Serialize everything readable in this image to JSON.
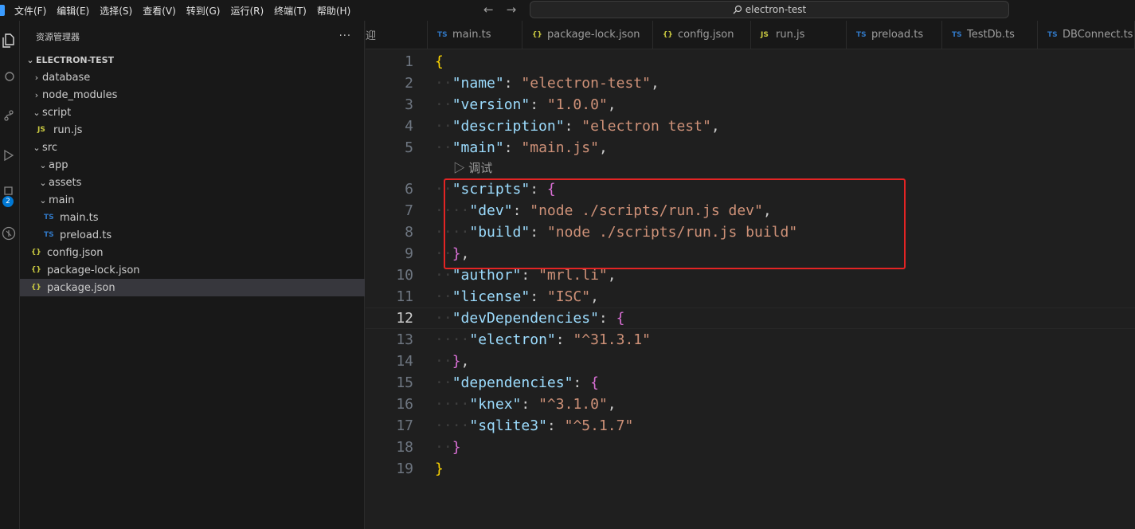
{
  "titlebar": {
    "menus": [
      "文件(F)",
      "编辑(E)",
      "选择(S)",
      "查看(V)",
      "转到(G)",
      "运行(R)",
      "终端(T)",
      "帮助(H)"
    ],
    "search_text": "electron-test"
  },
  "sidebar": {
    "title": "资源管理器",
    "more": "···",
    "root": "ELECTRON-TEST",
    "items": [
      {
        "label": "database",
        "kind": "folder-collapsed"
      },
      {
        "label": "node_modules",
        "kind": "folder-collapsed"
      },
      {
        "label": "script",
        "kind": "folder-open"
      },
      {
        "label": "run.js",
        "kind": "js"
      },
      {
        "label": "src",
        "kind": "folder-open"
      },
      {
        "label": "app",
        "kind": "folder-open"
      },
      {
        "label": "assets",
        "kind": "folder-open"
      },
      {
        "label": "main",
        "kind": "folder-open"
      },
      {
        "label": "main.ts",
        "kind": "ts"
      },
      {
        "label": "preload.ts",
        "kind": "ts"
      },
      {
        "label": "config.json",
        "kind": "json"
      },
      {
        "label": "package-lock.json",
        "kind": "json"
      },
      {
        "label": "package.json",
        "kind": "json",
        "selected": true
      }
    ],
    "badge_count": "2"
  },
  "tabs": [
    {
      "label": "迎",
      "kind": ""
    },
    {
      "label": "main.ts",
      "kind": "ts"
    },
    {
      "label": "package-lock.json",
      "kind": "json"
    },
    {
      "label": "config.json",
      "kind": "json"
    },
    {
      "label": "run.js",
      "kind": "js"
    },
    {
      "label": "preload.ts",
      "kind": "ts"
    },
    {
      "label": "TestDb.ts",
      "kind": "ts"
    },
    {
      "label": "DBConnect.ts",
      "kind": "ts"
    }
  ],
  "icon_text": {
    "ts": "TS",
    "js": "JS",
    "json": "{}"
  },
  "editor": {
    "codelens": "▷ 调试",
    "current_line": "12",
    "lines": [
      {
        "n": "1",
        "t": "{"
      },
      {
        "n": "2",
        "t": "  \"name\": \"electron-test\","
      },
      {
        "n": "3",
        "t": "  \"version\": \"1.0.0\","
      },
      {
        "n": "4",
        "t": "  \"description\": \"electron test\","
      },
      {
        "n": "5",
        "t": "  \"main\": \"main.js\","
      },
      {
        "n": "6",
        "t": "  \"scripts\": {"
      },
      {
        "n": "7",
        "t": "    \"dev\": \"node ./scripts/run.js dev\","
      },
      {
        "n": "8",
        "t": "    \"build\": \"node ./scripts/run.js build\""
      },
      {
        "n": "9",
        "t": "  },"
      },
      {
        "n": "10",
        "t": "  \"author\": \"mrl.li\","
      },
      {
        "n": "11",
        "t": "  \"license\": \"ISC\","
      },
      {
        "n": "12",
        "t": "  \"devDependencies\": {"
      },
      {
        "n": "13",
        "t": "    \"electron\": \"^31.3.1\""
      },
      {
        "n": "14",
        "t": "  },"
      },
      {
        "n": "15",
        "t": "  \"dependencies\": {"
      },
      {
        "n": "16",
        "t": "    \"knex\": \"^3.1.0\","
      },
      {
        "n": "17",
        "t": "    \"sqlite3\": \"^5.1.7\""
      },
      {
        "n": "18",
        "t": "  }"
      },
      {
        "n": "19",
        "t": "}"
      }
    ]
  },
  "colors": {
    "highlight_box": "#e32424",
    "key": "#9cdcfe",
    "string": "#ce9178",
    "brace_level1": "#ffd700",
    "brace_level2": "#da70d6"
  }
}
